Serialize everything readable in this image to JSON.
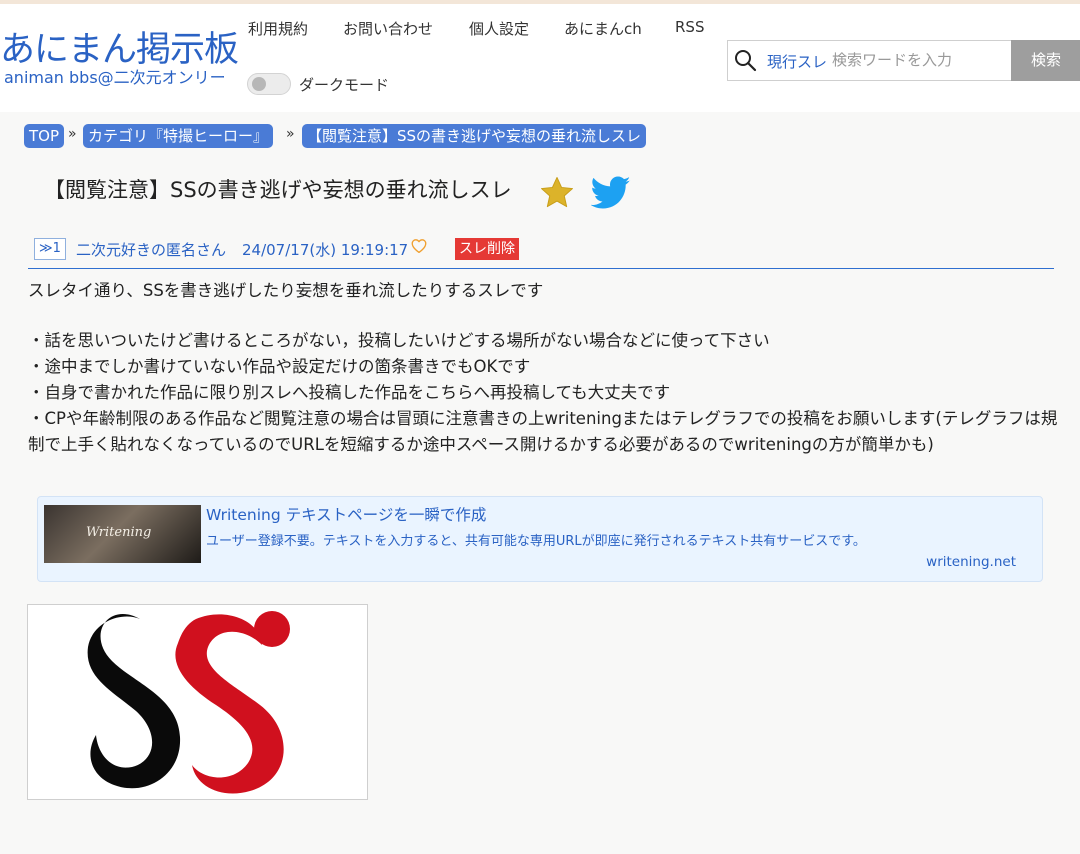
{
  "site": {
    "title": "あにまん掲示板",
    "subtitle": "animan bbs@二次元オンリー"
  },
  "nav": {
    "items": [
      "利用規約",
      "お問い合わせ",
      "個人設定",
      "あにまんch",
      "RSS"
    ]
  },
  "dark_mode": {
    "label": "ダークモード",
    "enabled": false
  },
  "search": {
    "scope": "現行スレ",
    "placeholder": "検索ワードを入力",
    "button": "検索"
  },
  "breadcrumb": [
    "TOP",
    "カテゴリ『特撮ヒーロー』",
    "【閲覧注意】SSの書き逃げや妄想の垂れ流しスレ"
  ],
  "breadcrumb_separator": "»",
  "thread": {
    "title": "【閲覧注意】SSの書き逃げや妄想の垂れ流しスレ"
  },
  "post": {
    "number": "≫1",
    "author": "二次元好きの匿名さん",
    "date": "24/07/17(水) 19:19:17",
    "delete_label": "スレ削除",
    "body": [
      "スレタイ通り、SSを書き逃げしたり妄想を垂れ流したりするスレです",
      "",
      "・話を思いついたけど書けるところがない，投稿したいけどする場所がない場合などに使って下さい",
      "・途中までしか書けていない作品や設定だけの箇条書きでもOKです",
      "・自身で書かれた作品に限り別スレへ投稿した作品をこちらへ再投稿しても大丈夫です",
      "・CPや年齢制限のある作品など閲覧注意の場合は冒頭に注意書きの上writeningまたはテレグラフでの投稿をお願いします(テレグラフは規制で上手く貼れなくなっているのでURLを短縮するか途中スペース開けるかする必要があるのでwriteningの方が簡単かも)"
    ]
  },
  "link_card": {
    "thumb_text": "Writening",
    "title": "Writening テキストページを一瞬で作成",
    "description": "ユーザー登録不要。テキストを入力すると、共有可能な専用URLが即座に発行されるテキスト共有サービスです。",
    "domain": "writening.net"
  },
  "colors": {
    "accent": "#2a62c4",
    "crumb_bg": "#4a7bd6",
    "delete": "#e53935",
    "star": "#dcb32a",
    "twitter": "#1da1f2",
    "heart": "#f0a030",
    "logo_black": "#0a0a0a",
    "logo_red": "#d0101e"
  }
}
